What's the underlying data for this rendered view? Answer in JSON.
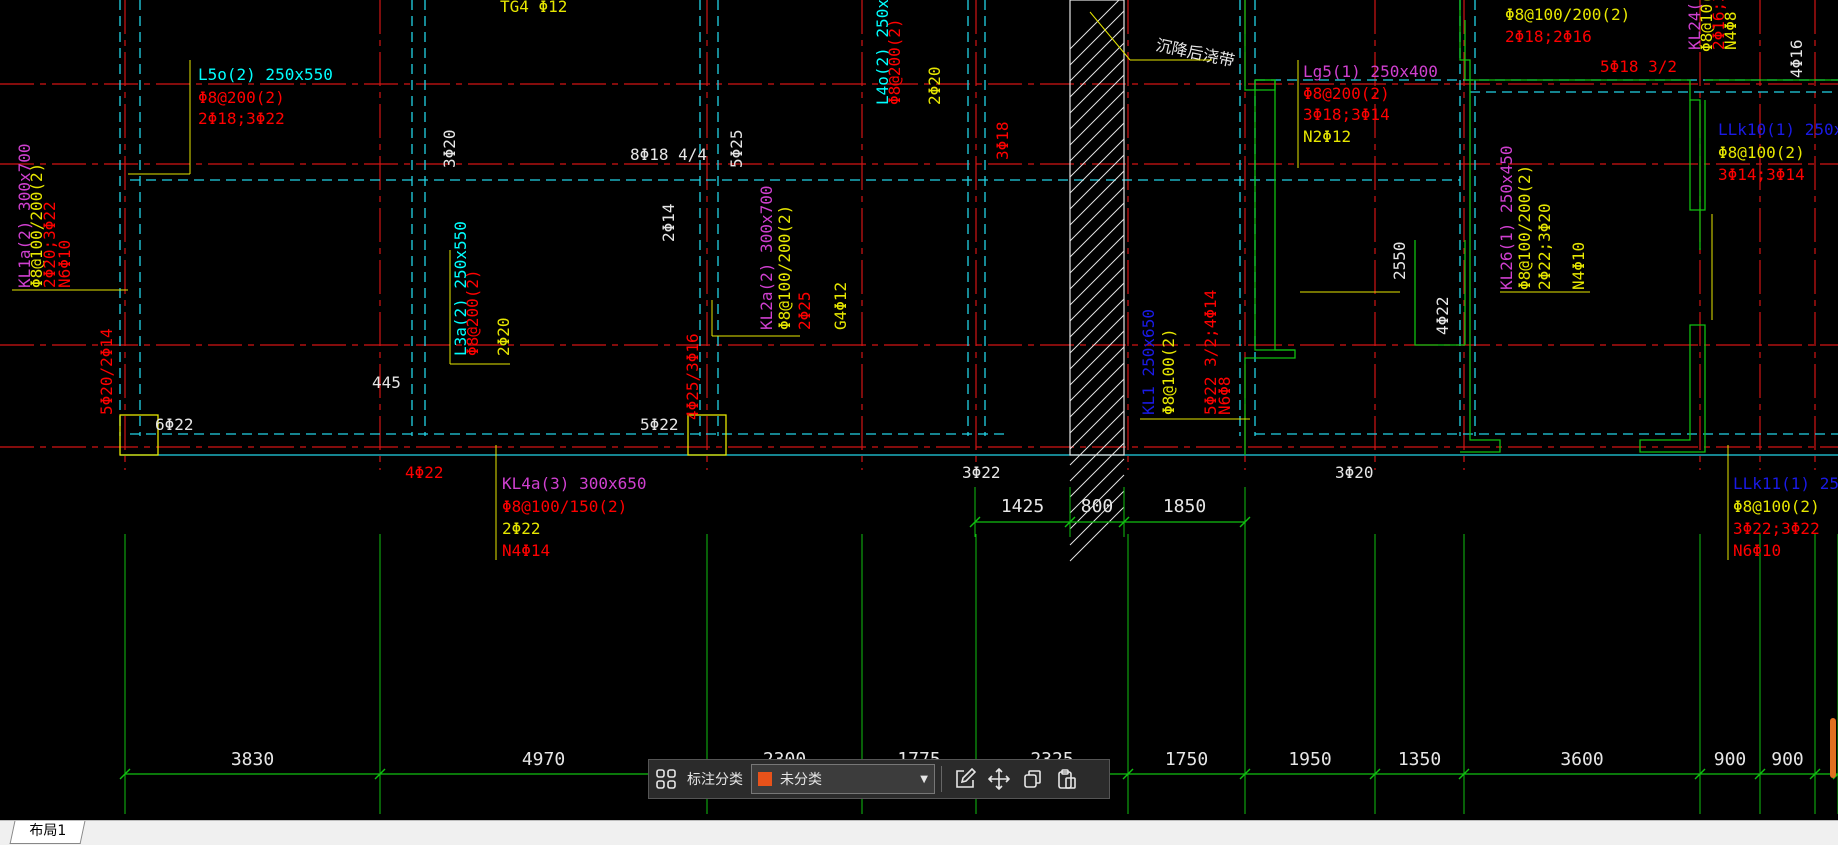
{
  "drawing": {
    "colors": {
      "red_grid": "#d21414",
      "green_dim": "#10c010",
      "cyan_beam": "#22d3e6",
      "yellow": "#e6e600",
      "magenta": "#d040d0",
      "blue": "#1a1ae6",
      "white": "#e6e6e6"
    },
    "bottom_dims": [
      "3830",
      "4970",
      "2300",
      "1775",
      "2325",
      "1750",
      "1950",
      "1350",
      "3600",
      "900",
      "900"
    ],
    "mid_dims": [
      "1425",
      "800",
      "1850"
    ],
    "annotations": [
      {
        "text": "TG4 Φ12",
        "color": "yellow"
      },
      {
        "text": "L5o(2) 250x550",
        "color": "cyan"
      },
      {
        "text": "Φ8@200(2)",
        "color": "red"
      },
      {
        "text": "2Φ18;3Φ22",
        "color": "red"
      },
      {
        "text": "L4o(2) 250x55",
        "color": "cyan"
      },
      {
        "text": "Φ8@200(2)",
        "color": "red"
      },
      {
        "text": "2Φ20",
        "color": "yellow"
      },
      {
        "text": "沉降后浇带",
        "color": "white"
      },
      {
        "text": "Lg5(1) 250x400",
        "color": "magenta"
      },
      {
        "text": "Φ8@200(2)",
        "color": "red"
      },
      {
        "text": "3Φ18;3Φ14",
        "color": "red"
      },
      {
        "text": "N2Φ12",
        "color": "yellow"
      },
      {
        "text": "Φ8@100/200(2)",
        "color": "yellow"
      },
      {
        "text": "2Φ18;2Φ16",
        "color": "red"
      },
      {
        "text": "KL24(1",
        "color": "magenta"
      },
      {
        "text": "Φ8@10(",
        "color": "yellow"
      },
      {
        "text": "2Φ16;3",
        "color": "red"
      },
      {
        "text": "N4Φ8",
        "color": "yellow"
      },
      {
        "text": "4Φ16",
        "color": "white"
      },
      {
        "text": "5Φ18 3/2",
        "color": "red"
      },
      {
        "text": "LLk10(1) 250x6",
        "color": "blue"
      },
      {
        "text": "Φ8@100(2)",
        "color": "yellow"
      },
      {
        "text": "3Φ14;3Φ14",
        "color": "red"
      },
      {
        "text": "KL1a(2) 300x700",
        "color": "magenta"
      },
      {
        "text": "Φ8@100/200(2)",
        "color": "yellow"
      },
      {
        "text": "2Φ20;3Φ22",
        "color": "red"
      },
      {
        "text": "N6Φ10",
        "color": "red"
      },
      {
        "text": "3Φ20",
        "color": "white"
      },
      {
        "text": "8Φ18 4/4",
        "color": "white"
      },
      {
        "text": "5Φ25",
        "color": "white"
      },
      {
        "text": "3Φ18",
        "color": "red"
      },
      {
        "text": "2Φ14",
        "color": "white"
      },
      {
        "text": "L3a(2) 250x550",
        "color": "cyan"
      },
      {
        "text": "Φ8@200(2)",
        "color": "red"
      },
      {
        "text": "2Φ20",
        "color": "yellow"
      },
      {
        "text": "KL2a(2) 300x700",
        "color": "magenta"
      },
      {
        "text": "Φ8@100/200(2)",
        "color": "yellow"
      },
      {
        "text": "2Φ25",
        "color": "red"
      },
      {
        "text": "G4Φ12",
        "color": "yellow"
      },
      {
        "text": "2550",
        "color": "white"
      },
      {
        "text": "KL26(1) 250x450",
        "color": "magenta"
      },
      {
        "text": "Φ8@100/200(2)",
        "color": "yellow"
      },
      {
        "text": "2Φ22;3Φ20",
        "color": "yellow"
      },
      {
        "text": "N4Φ10",
        "color": "yellow"
      },
      {
        "text": "4Φ22",
        "color": "white"
      },
      {
        "text": "5Φ20/2Φ14",
        "color": "red"
      },
      {
        "text": "445",
        "color": "white"
      },
      {
        "text": "6Φ22",
        "color": "white"
      },
      {
        "text": "5Φ22",
        "color": "white"
      },
      {
        "text": "4Φ25/3Φ16",
        "color": "red"
      },
      {
        "text": "KL1 250x650",
        "color": "blue"
      },
      {
        "text": "Φ8@100(2)",
        "color": "yellow"
      },
      {
        "text": "5Φ22 3/2;4Φ14",
        "color": "red"
      },
      {
        "text": "N6Φ8",
        "color": "red"
      },
      {
        "text": "4Φ22",
        "color": "red"
      },
      {
        "text": "KL4a(3) 300x650",
        "color": "magenta"
      },
      {
        "text": "Φ8@100/150(2)",
        "color": "red"
      },
      {
        "text": "2Φ22",
        "color": "yellow"
      },
      {
        "text": "N4Φ14",
        "color": "red"
      },
      {
        "text": "3Φ22",
        "color": "white"
      },
      {
        "text": "3Φ20",
        "color": "white"
      },
      {
        "text": "LLk11(1) 250x6",
        "color": "blue"
      },
      {
        "text": "Φ8@100(2)",
        "color": "yellow"
      },
      {
        "text": "3Φ22;3Φ22",
        "color": "red"
      },
      {
        "text": "N6Φ10",
        "color": "red"
      }
    ]
  },
  "toolbar": {
    "label": "标注分类",
    "category": {
      "value": "未分类",
      "swatch": "#e8521a"
    },
    "icons": [
      "grid-icon",
      "edit-icon",
      "move-icon",
      "copy-icon",
      "paste-icon"
    ]
  },
  "tabs": {
    "layout": "布局1"
  }
}
